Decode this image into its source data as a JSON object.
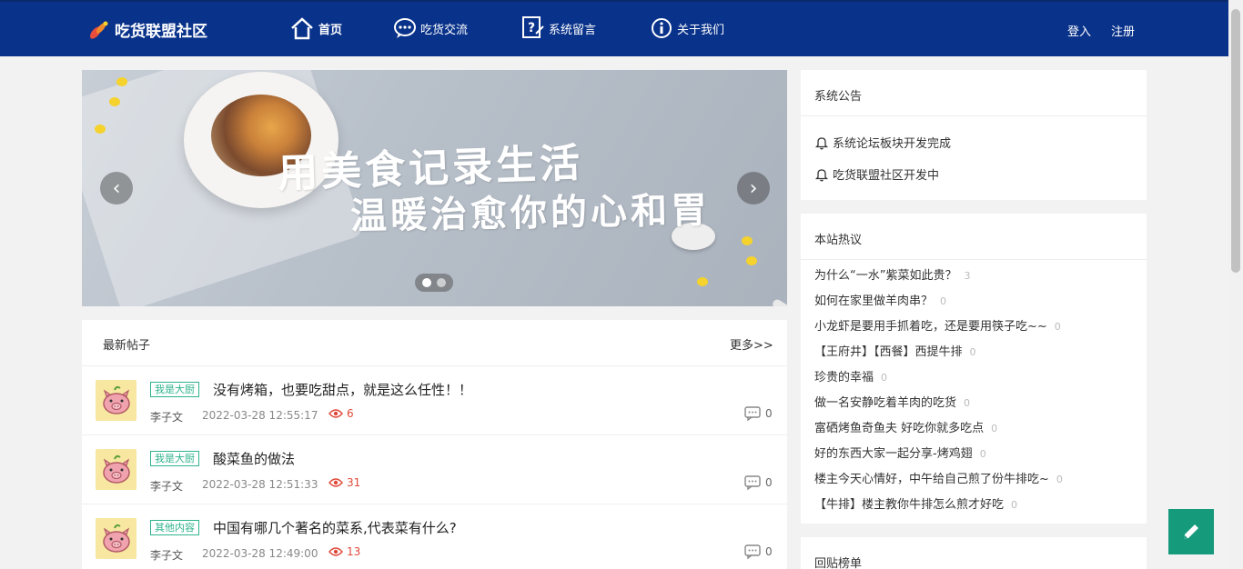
{
  "header": {
    "brand": "吃货联盟社区",
    "nav": [
      {
        "label": "首页",
        "icon": "home-icon"
      },
      {
        "label": "吃货交流",
        "icon": "chat-bubble-icon"
      },
      {
        "label": "系统留言",
        "icon": "help-note-icon"
      },
      {
        "label": "关于我们",
        "icon": "info-icon"
      }
    ],
    "login": "登入",
    "register": "注册"
  },
  "carousel": {
    "line1": "用美食记录生活",
    "line2": "温暖治愈你的心和胃",
    "prev_arrow": "‹",
    "next_arrow": "›",
    "slide_count": 2,
    "active_slide": 1
  },
  "posts": {
    "title": "最新帖子",
    "more": "更多>>",
    "items": [
      {
        "tag": "我是大厨",
        "title": "没有烤箱，也要吃甜点，就是这么任性！！",
        "author": "李子文",
        "time": "2022-03-28 12:55:17",
        "views": "6",
        "comments": "0"
      },
      {
        "tag": "我是大厨",
        "title": "酸菜鱼的做法",
        "author": "李子文",
        "time": "2022-03-28 12:51:33",
        "views": "31",
        "comments": "0"
      },
      {
        "tag": "其他内容",
        "title": "中国有哪几个著名的菜系,代表菜有什么?",
        "author": "李子文",
        "time": "2022-03-28 12:49:00",
        "views": "13",
        "comments": "0"
      }
    ]
  },
  "announcements": {
    "title": "系统公告",
    "items": [
      "系统论坛板块开发完成",
      "吃货联盟社区开发中"
    ]
  },
  "hot": {
    "title": "本站热议",
    "items": [
      {
        "title": "为什么“一水”紫菜如此贵？",
        "count": "3"
      },
      {
        "title": "如何在家里做羊肉串？",
        "count": "0"
      },
      {
        "title": "小龙虾是要用手抓着吃，还是要用筷子吃~~",
        "count": "0"
      },
      {
        "title": "【王府井】【西餐】西提牛排",
        "count": "0"
      },
      {
        "title": "珍贵的幸福",
        "count": "0"
      },
      {
        "title": "做一名安静吃着羊肉的吃货",
        "count": "0"
      },
      {
        "title": "富硒烤鱼奇鱼夫 好吃你就多吃点",
        "count": "0"
      },
      {
        "title": "好的东西大家一起分享-烤鸡翅",
        "count": "0"
      },
      {
        "title": "楼主今天心情好，中午给自己煎了份牛排吃~",
        "count": "0"
      },
      {
        "title": "【牛排】楼主教你牛排怎么煎才好吃",
        "count": "0"
      }
    ]
  },
  "reply_rank": {
    "title": "回贴榜单"
  },
  "fab": {
    "icon": "pencil-icon"
  },
  "colors": {
    "nav_bg": "#09328a",
    "tag": "#2db38c",
    "views": "#e0483a",
    "fab": "#159a7c"
  }
}
